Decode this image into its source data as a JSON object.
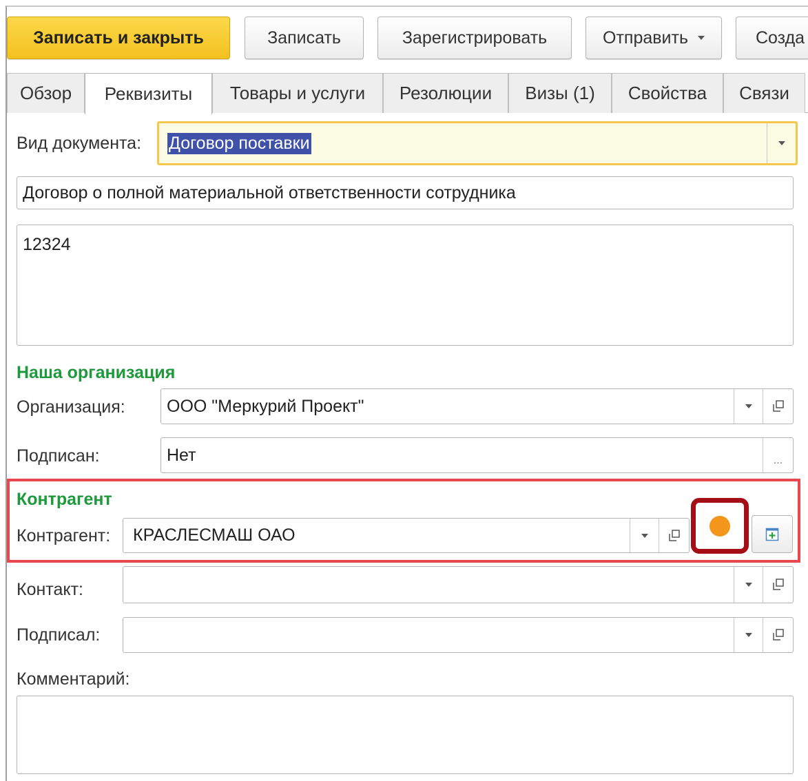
{
  "toolbar": {
    "save_close": "Записать и закрыть",
    "save": "Записать",
    "register": "Зарегистрировать",
    "send": "Отправить",
    "create": "Созда"
  },
  "tabs": [
    {
      "label": "Обзор",
      "active": false
    },
    {
      "label": "Реквизиты",
      "active": true
    },
    {
      "label": "Товары и услуги",
      "active": false
    },
    {
      "label": "Резолюции",
      "active": false
    },
    {
      "label": "Визы (1)",
      "active": false
    },
    {
      "label": "Свойства",
      "active": false
    },
    {
      "label": "Связи",
      "active": false
    }
  ],
  "doc_type": {
    "label": "Вид документа:",
    "value": "Договор поставки"
  },
  "title_value": "Договор о полной материальной ответственности сотрудника",
  "content_value": "12324",
  "our_org": {
    "section": "Наша организация",
    "org_label": "Организация:",
    "org_value": "ООО \"Меркурий Проект\"",
    "signed_label": "Подписан:",
    "signed_value": "Нет"
  },
  "counterparty": {
    "section": "Контрагент",
    "label": "Контрагент:",
    "value": "КРАСЛЕСМАШ  ОАО",
    "status_color": "#f4961c"
  },
  "contact": {
    "label": "Контакт:",
    "value": ""
  },
  "signer": {
    "label": "Подписал:",
    "value": ""
  },
  "comment": {
    "label": "Комментарий:",
    "value": ""
  },
  "colors": {
    "accent": "#f3c11f",
    "section": "#1e9a3c",
    "highlight": "#e9474e",
    "status_box": "#a50e16"
  }
}
